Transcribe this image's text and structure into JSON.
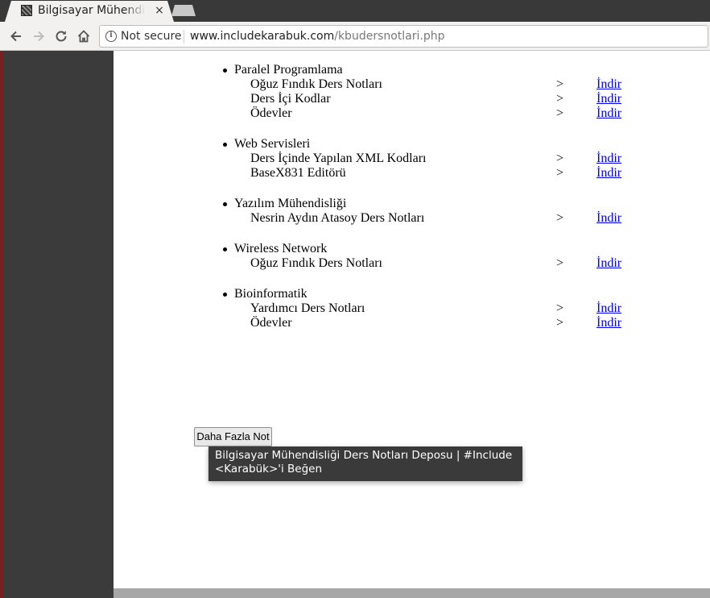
{
  "browser": {
    "tab_title": "Bilgisayar Mühendisliği Ders Notları Deposu | #Include <Karabük>",
    "tab_close": "×",
    "security_label": "Not secure",
    "url_host": "www.includekarabuk.com",
    "url_path": "/kbudersnotlari.php"
  },
  "colors": {
    "link": "#0000ee",
    "tooltip_bg": "#3a3a3a",
    "sidebar": "#3b3b3b"
  },
  "courses": [
    {
      "title": "Paralel Programlama",
      "items": [
        {
          "label": "Oğuz Fındık Ders Notları",
          "arrow": ">",
          "link": "İndir"
        },
        {
          "label": "Ders İçi Kodlar",
          "arrow": ">",
          "link": "İndir"
        },
        {
          "label": "Ödevler",
          "arrow": ">",
          "link": "İndir"
        }
      ]
    },
    {
      "title": "Web Servisleri",
      "items": [
        {
          "label": "Ders İçinde Yapılan XML Kodları",
          "arrow": ">",
          "link": "İndir"
        },
        {
          "label": "BaseX831 Editörü",
          "arrow": ">",
          "link": "İndir"
        }
      ]
    },
    {
      "title": "Yazılım Mühendisliği",
      "items": [
        {
          "label": "Nesrin Aydın Atasoy Ders Notları",
          "arrow": ">",
          "link": "İndir"
        }
      ]
    },
    {
      "title": "Wireless Network",
      "items": [
        {
          "label": "Oğuz Fındık Ders Notları",
          "arrow": ">",
          "link": "İndir"
        }
      ]
    },
    {
      "title": "Bioinformatik",
      "items": [
        {
          "label": "Yardımcı Ders Notları",
          "arrow": ">",
          "link": "İndir"
        },
        {
          "label": "Ödevler",
          "arrow": ">",
          "link": "İndir"
        }
      ]
    }
  ],
  "more_button": "Daha Fazla Not",
  "tooltip": "Bilgisayar Mühendisliği Ders Notları Deposu | #Include <Karabük>'i Beğen"
}
